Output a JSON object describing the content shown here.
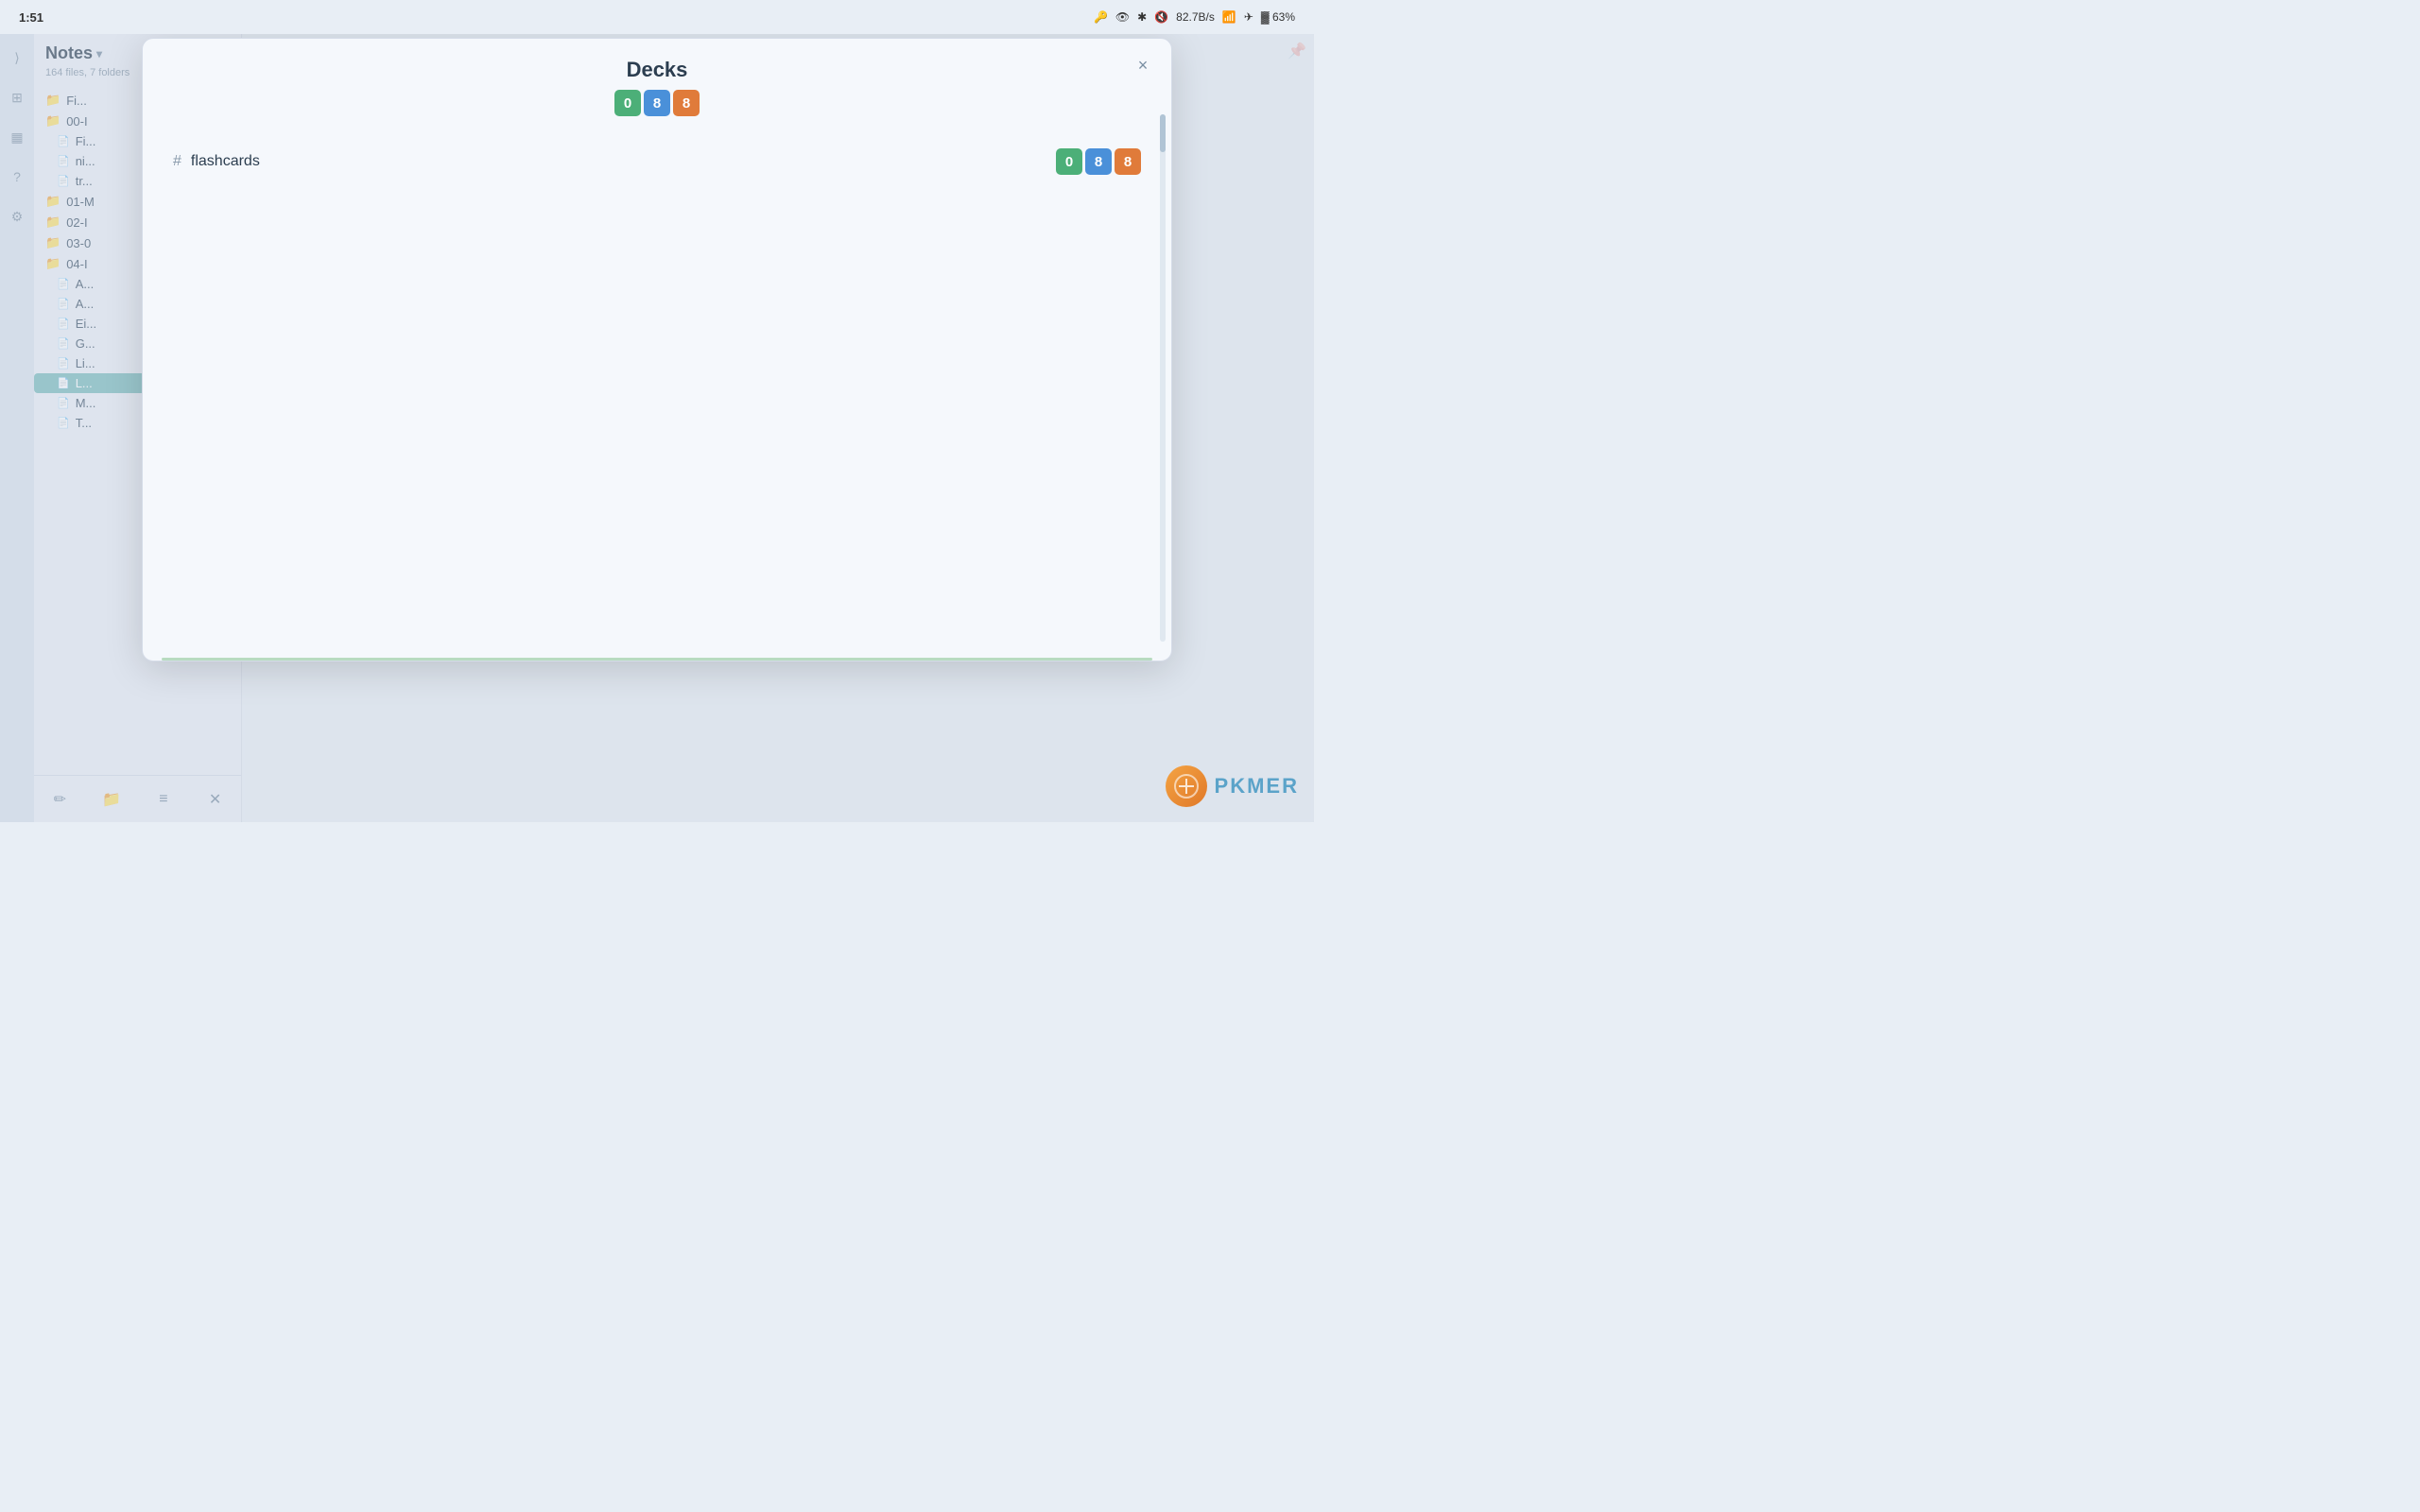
{
  "statusBar": {
    "time": "1:51",
    "rightIcons": [
      "🔑",
      "👁",
      "🔵",
      "📶",
      "82.7B/s",
      "📡",
      "✈",
      "🔋",
      "63%"
    ]
  },
  "filePanel": {
    "title": "Notes",
    "subtitle": "164 files, 7 folders",
    "items": [
      {
        "type": "section",
        "label": "Files",
        "indent": 0
      },
      {
        "type": "folder",
        "label": "00-I",
        "indent": 0
      },
      {
        "type": "file",
        "label": "Fi...",
        "indent": 1
      },
      {
        "type": "file",
        "label": "ni...",
        "indent": 1
      },
      {
        "type": "file",
        "label": "tr...",
        "indent": 1
      },
      {
        "type": "folder",
        "label": "01-M",
        "indent": 0
      },
      {
        "type": "folder",
        "label": "02-I",
        "indent": 0
      },
      {
        "type": "folder",
        "label": "03-0",
        "indent": 0
      },
      {
        "type": "folder",
        "label": "04-I",
        "indent": 0
      },
      {
        "type": "file",
        "label": "A...",
        "indent": 1
      },
      {
        "type": "file",
        "label": "A...",
        "indent": 1
      },
      {
        "type": "file",
        "label": "Ei...",
        "indent": 1
      },
      {
        "type": "file",
        "label": "G...",
        "indent": 1
      },
      {
        "type": "file",
        "label": "Li...",
        "indent": 1
      },
      {
        "type": "file",
        "label": "L...",
        "indent": 1,
        "active": true
      },
      {
        "type": "file",
        "label": "M...",
        "indent": 1
      },
      {
        "type": "file",
        "label": "T...",
        "indent": 1
      }
    ]
  },
  "toolbar": {
    "buttons": [
      "✏",
      "📁",
      "≡",
      "✕"
    ]
  },
  "modal": {
    "title": "Decks",
    "badges": [
      {
        "value": "0",
        "color": "green"
      },
      {
        "value": "8",
        "color": "blue"
      },
      {
        "value": "8",
        "color": "orange"
      }
    ],
    "closeLabel": "×",
    "decks": [
      {
        "prefix": "#",
        "name": "flashcards",
        "badges": [
          {
            "value": "0",
            "color": "green"
          },
          {
            "value": "8",
            "color": "blue"
          },
          {
            "value": "8",
            "color": "orange"
          }
        ]
      }
    ]
  },
  "pkmer": {
    "text": "PKMER"
  }
}
